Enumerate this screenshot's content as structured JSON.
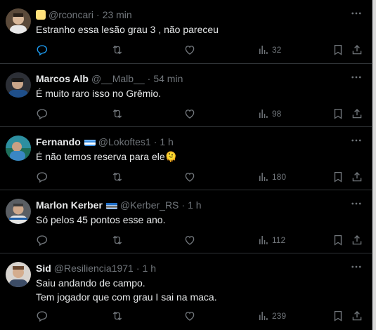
{
  "replies": [
    {
      "name": "",
      "handle": "@rconcari",
      "time": "23 min",
      "badge": "emoji-badge",
      "flag": null,
      "text": [
        "Estranho essa lesão grau 3 , não pareceu"
      ],
      "stats": {
        "views": "32"
      },
      "avatar_bg": "#6a5a45"
    },
    {
      "name": "Marcos Alb",
      "handle": "@__Malb__",
      "time": "54 min",
      "flag": null,
      "text": [
        "É muito raro isso no Grêmio."
      ],
      "stats": {
        "views": "98"
      },
      "avatar_bg": "#3a3f48"
    },
    {
      "name": "Fernando",
      "handle": "@Lokoftes1",
      "time": "1 h",
      "flag": "gremio-flag-icon",
      "text": [
        "É não temos reserva para ele🫠"
      ],
      "stats": {
        "views": "180"
      },
      "avatar_bg": "#2b7a8a"
    },
    {
      "name": "Marlon Kerber",
      "handle": "@Kerber_RS",
      "time": "1 h",
      "flag": "gremio-flag-icon",
      "text": [
        "Só pelos 45 pontos esse ano."
      ],
      "stats": {
        "views": "112"
      },
      "avatar_bg": "#4a4d52"
    },
    {
      "name": "Sid",
      "handle": "@Resiliencia1971",
      "time": "1 h",
      "flag": null,
      "text": [
        "Saiu andando de campo.",
        "Tem jogador que com grau I sai na maca."
      ],
      "stats": {
        "views": "239"
      },
      "avatar_bg": "#8a7a6a"
    }
  ],
  "colors": {
    "background": "#000000",
    "text": "#e7e9ea",
    "muted": "#71767b",
    "divider": "#2f3336",
    "reply_active": "#1d9bf0"
  },
  "icons": [
    "reply-icon",
    "retweet-icon",
    "like-icon",
    "views-icon",
    "bookmark-icon",
    "share-icon",
    "more-icon"
  ]
}
